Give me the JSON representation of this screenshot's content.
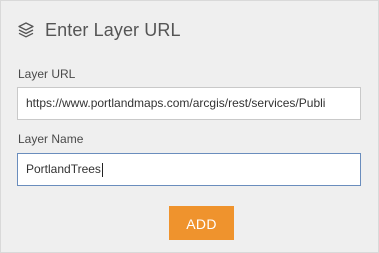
{
  "header": {
    "icon": "layers-icon",
    "title": "Enter Layer URL"
  },
  "form": {
    "url_label": "Layer URL",
    "url_value": "https://www.portlandmaps.com/arcgis/rest/services/Publi",
    "name_label": "Layer Name",
    "name_value": "PortlandTrees",
    "add_label": "ADD"
  },
  "colors": {
    "panel_bg": "#efefef",
    "add_button": "#ef932d",
    "focused_border": "#6a8dbd"
  }
}
